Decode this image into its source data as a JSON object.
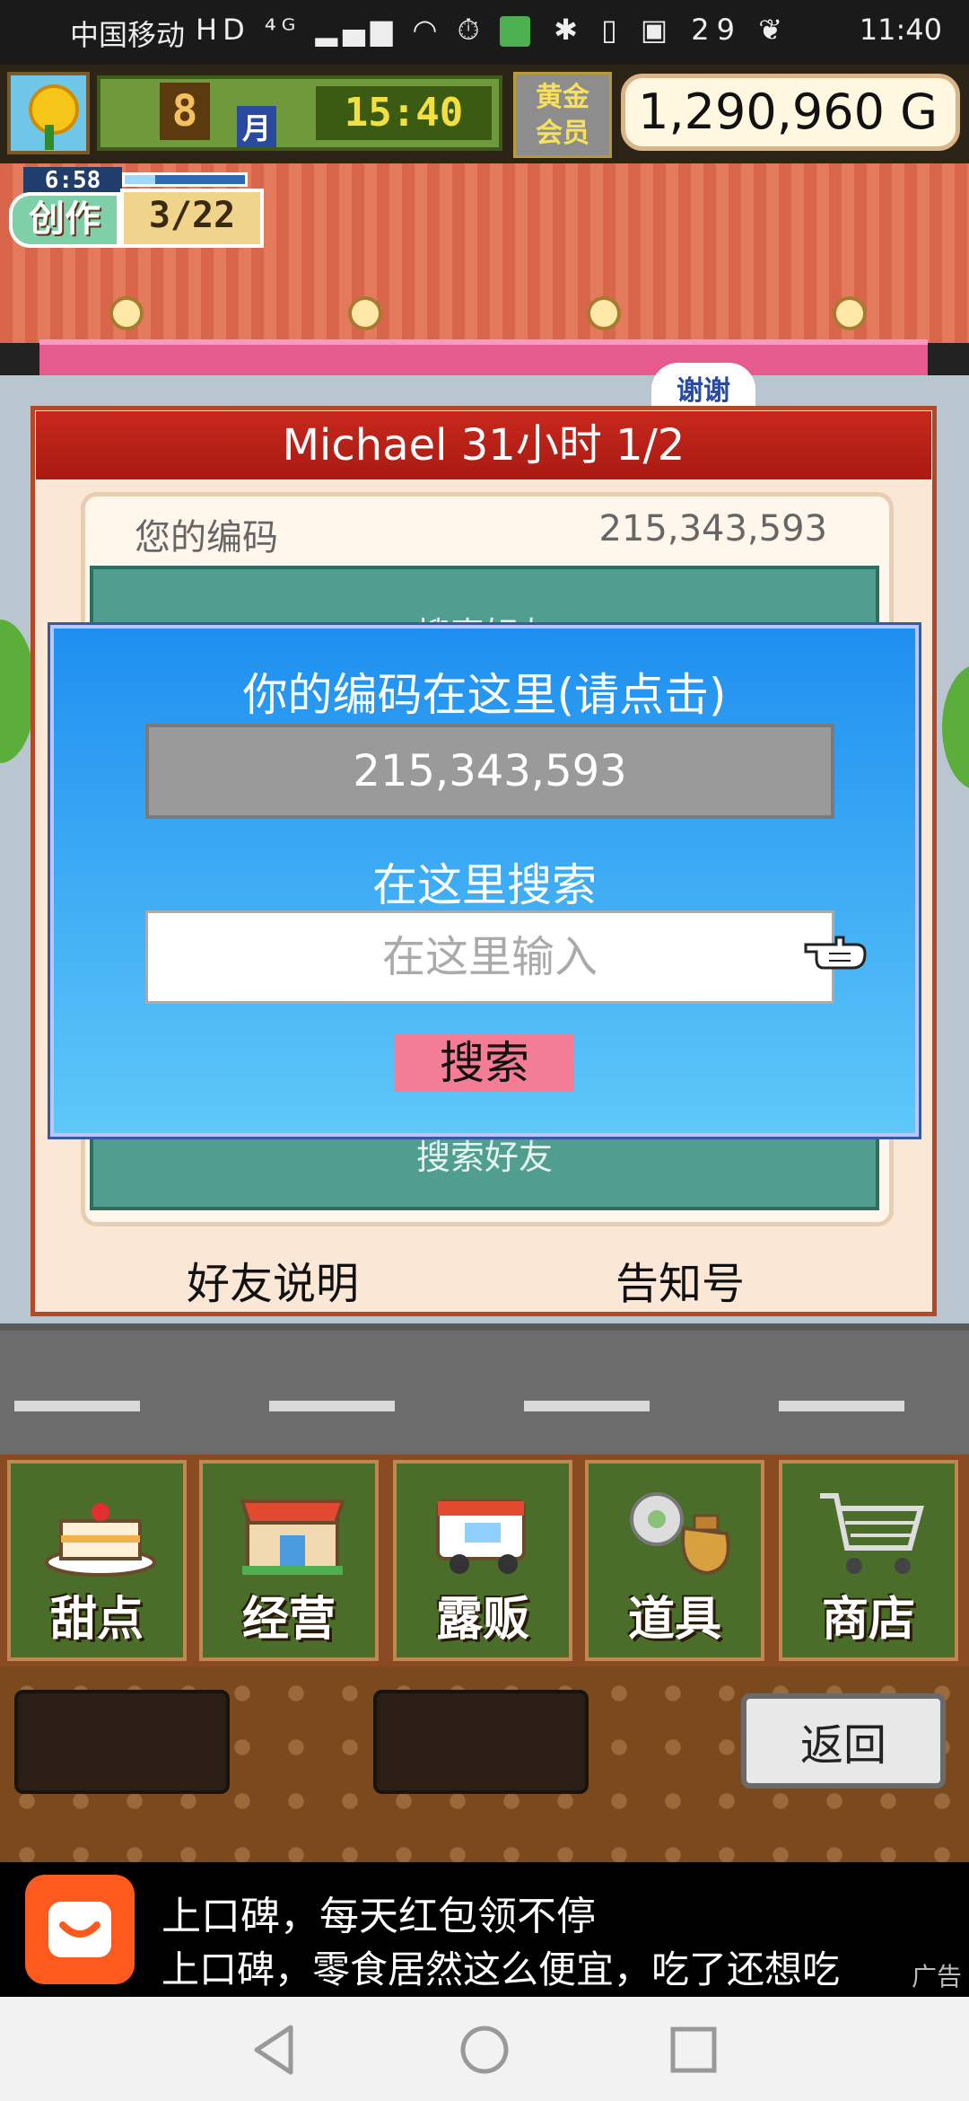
{
  "status_bar": {
    "carrier": "中国移动",
    "network": "HD ⁴ᴳ",
    "battery": "29",
    "time": "11:40"
  },
  "hud": {
    "month_number": "8",
    "month_label": "月",
    "clock": "15:40",
    "gold_member_line1": "黄金",
    "gold_member_line2": "会员",
    "money": "1,290,960 G"
  },
  "create": {
    "timer": "6:58",
    "label": "创作",
    "count": "3/22",
    "progress": 0.25
  },
  "scene": {
    "thanks_sign": "谢谢"
  },
  "friend_panel": {
    "title": "Michael  31小时 1/2",
    "your_code_label": "您的编码",
    "your_code_value": "215,343,593",
    "teal_top_text": "搜索好友",
    "teal_bottom_text": "搜索好友",
    "friend_help": "好友说明",
    "notice": "告知号"
  },
  "dialog": {
    "title": "你的编码在这里(请点击)",
    "code_value": "215,343,593",
    "search_label": "在这里搜索",
    "search_placeholder": "在这里输入",
    "search_button": "搜索"
  },
  "menu": [
    {
      "label": "甜点",
      "icon": "cake-icon"
    },
    {
      "label": "经营",
      "icon": "store-icon"
    },
    {
      "label": "露贩",
      "icon": "food-truck-icon"
    },
    {
      "label": "道具",
      "icon": "item-bag-icon"
    },
    {
      "label": "商店",
      "icon": "shopping-cart-icon"
    }
  ],
  "back_button": "返回",
  "ad": {
    "line1": "上口碑，每天红包领不停",
    "line2": "上口碑，零食居然这么便宜，吃了还想吃",
    "tag": "广告"
  },
  "colors": {
    "panel_title": "#b8201a",
    "dialog_blue": "#1e8ff0",
    "search_button": "#f47d96"
  }
}
